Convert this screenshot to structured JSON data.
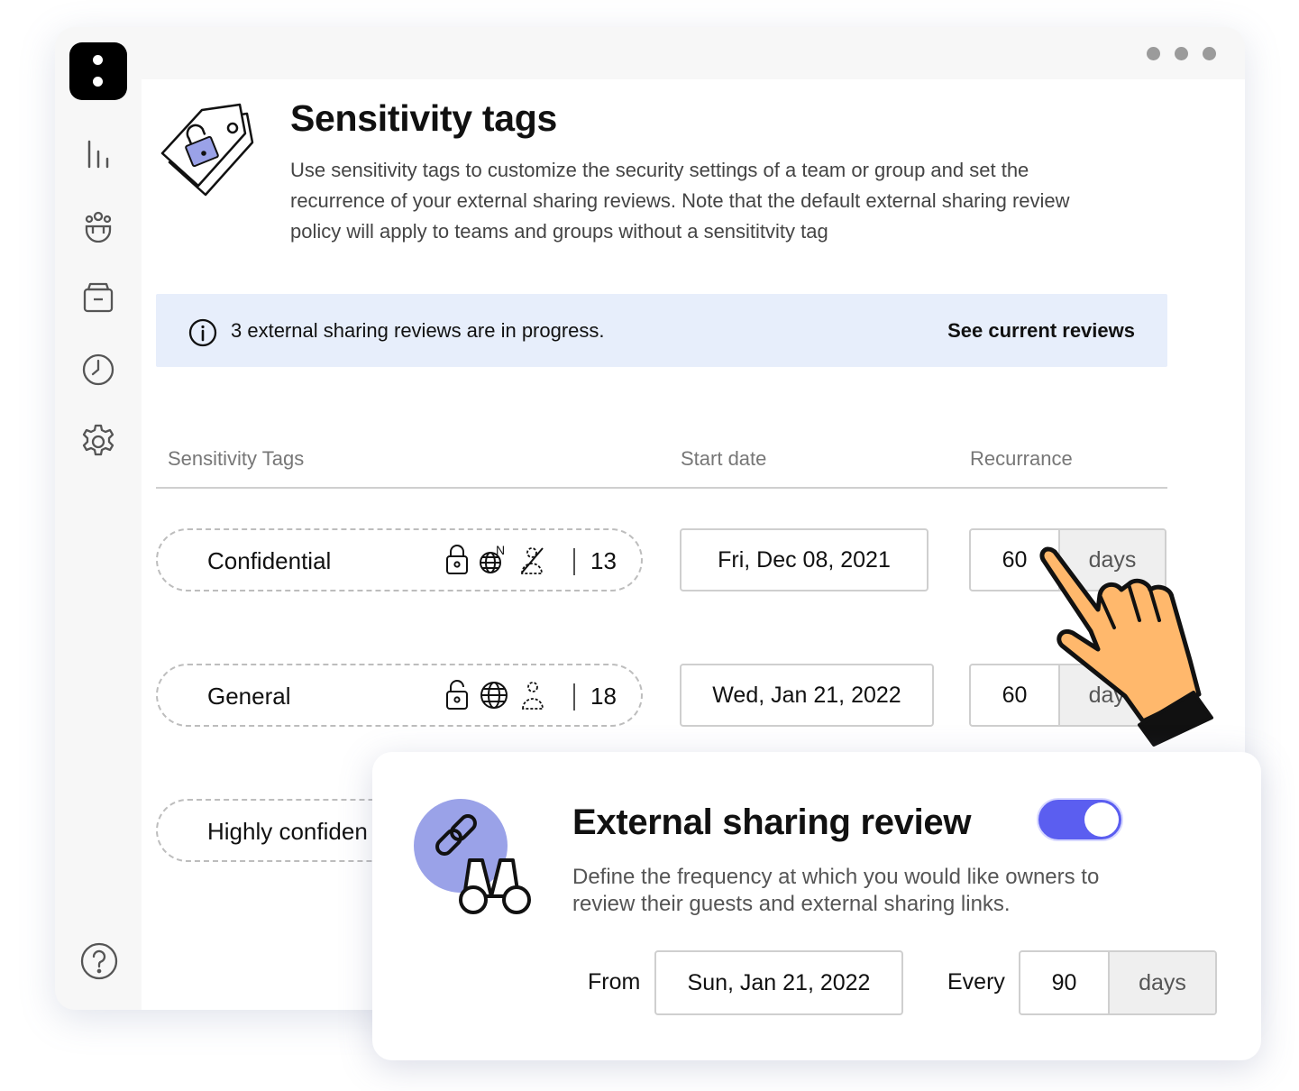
{
  "header": {
    "title": "Sensitivity tags",
    "description": "Use sensitivity tags to customize the security settings of a team or group and set the recurrence of your external sharing reviews. Note that the default external sharing review policy will apply to teams and groups without a sensititvity tag"
  },
  "sidebar": {
    "items": [
      "analytics-icon",
      "users-icon",
      "archive-icon",
      "history-icon",
      "settings-icon"
    ],
    "help": "help-icon"
  },
  "banner": {
    "text": "3 external sharing reviews are in progress.",
    "link": "See current reviews"
  },
  "table": {
    "columns": [
      "Sensitivity Tags",
      "Start date",
      "Recurrance"
    ],
    "rows": [
      {
        "tag": "Confidential",
        "count": "13",
        "start": "Fri, Dec 08, 2021",
        "every": "60",
        "unit": "days"
      },
      {
        "tag": "General",
        "count": "18",
        "start": "Wed, Jan 21, 2022",
        "every": "60",
        "unit": "days"
      },
      {
        "tag": "Highly confiden"
      }
    ]
  },
  "review_card": {
    "title": "External sharing review",
    "description": "Define the frequency at which you would like owners to review their guests and external sharing links.",
    "toggle_on": true,
    "from_label": "From",
    "from_date": "Sun, Jan 21, 2022",
    "every_label": "Every",
    "every_value": "90",
    "every_unit": "days"
  },
  "colors": {
    "accent": "#5b5ef0",
    "banner_bg": "#e7eefb",
    "illustration": "#9aa2e8",
    "hand": "#ffb86c"
  }
}
